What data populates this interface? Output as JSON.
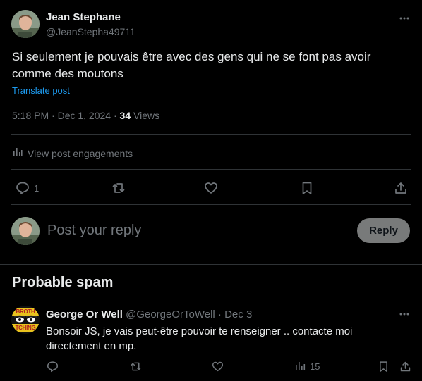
{
  "post": {
    "author_name": "Jean Stephane",
    "author_handle": "@JeanStepha49711",
    "text": "Si seulement je pouvais être avec des gens qui ne se font pas avoir comme des moutons",
    "translate_label": "Translate post",
    "timestamp": "5:18 PM · Dec 1, 2024 · ",
    "views_count": "34",
    "views_label": " Views",
    "engagements_label": "View post engagements",
    "reply_count": "1"
  },
  "reply_box": {
    "placeholder": "Post your reply",
    "button_label": "Reply"
  },
  "spam_section": {
    "heading": "Probable spam"
  },
  "spam_reply": {
    "author_name": "George Or Well",
    "author_handle": "@GeorgeOrToWell",
    "date": " · Dec 3",
    "text": "Bonsoir JS, je vais peut-être pouvoir te renseigner .. contacte moi directement en mp.",
    "views": "15",
    "avatar_text_top": "BROTH",
    "avatar_text_bottom": "TCHING"
  },
  "colors": {
    "accent": "#1d9bf0",
    "muted": "#71767b",
    "divider": "#2f3336",
    "reply_button_bg": "#787a7a"
  }
}
